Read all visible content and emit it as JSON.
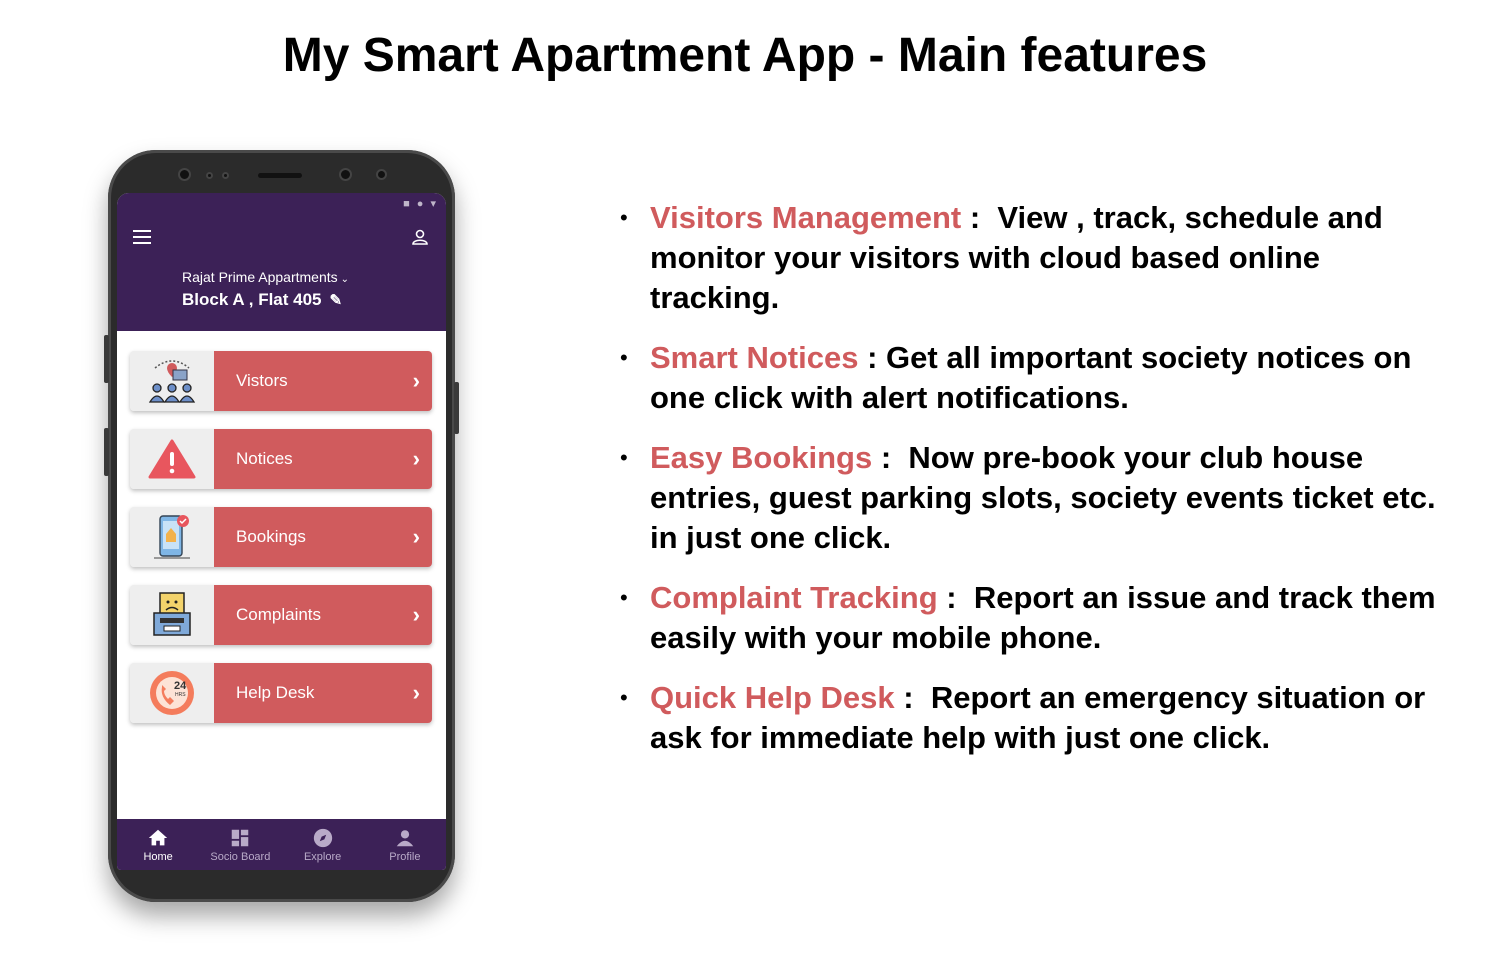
{
  "slide": {
    "title": "My Smart Apartment App - Main features"
  },
  "app": {
    "status_icons": "■ ● ▾",
    "society": "Rajat Prime Appartments",
    "flat": "Block A , Flat 405",
    "menu": [
      {
        "label": "Vistors",
        "icon": "visitors-icon"
      },
      {
        "label": "Notices",
        "icon": "warning-icon"
      },
      {
        "label": "Bookings",
        "icon": "booking-phone-icon"
      },
      {
        "label": "Complaints",
        "icon": "complaint-box-icon"
      },
      {
        "label": "Help Desk",
        "icon": "helpdesk-24hrs-icon"
      }
    ],
    "nav": [
      {
        "label": "Home",
        "icon": "home-icon"
      },
      {
        "label": "Socio Board",
        "icon": "dashboard-icon"
      },
      {
        "label": "Explore",
        "icon": "compass-icon"
      },
      {
        "label": "Profile",
        "icon": "person-icon"
      }
    ],
    "colors": {
      "header": "#3c2157",
      "accent": "#d05b5d"
    }
  },
  "features": [
    {
      "title": "Visitors Management",
      "sep": " :  ",
      "text": "View , track, schedule and monitor your visitors with cloud based online tracking."
    },
    {
      "title": "Smart Notices",
      "sep": " : ",
      "text": "Get all important society notices on one click with alert notifications."
    },
    {
      "title": "Easy Bookings",
      "sep": " :  ",
      "text": "Now pre-book your club house entries, guest parking slots, society events ticket etc. in just one click."
    },
    {
      "title": "Complaint Tracking",
      "sep": " :  ",
      "text": "Report an issue and track them easily with your mobile phone."
    },
    {
      "title": "Quick Help Desk",
      "sep": " :  ",
      "text": "Report an emergency situation or ask for immediate help with just one click."
    }
  ]
}
